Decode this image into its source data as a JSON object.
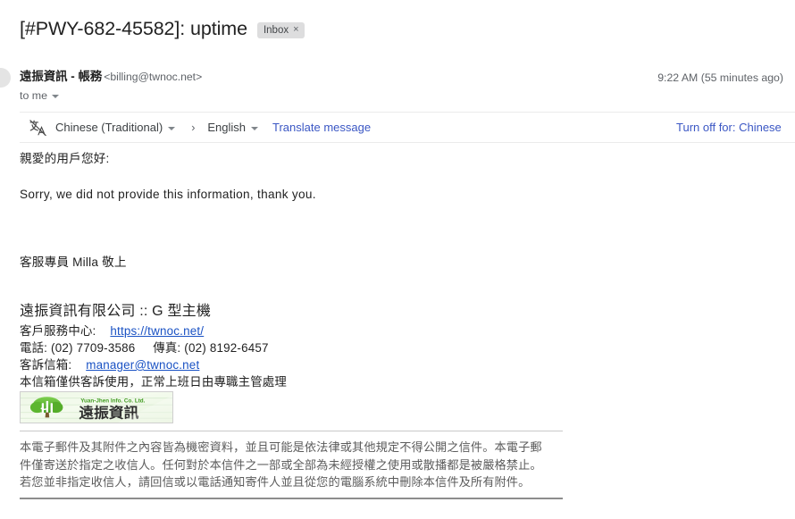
{
  "subject": {
    "text": "[#PWY-682-45582]: uptime",
    "label_chip": "Inbox",
    "label_chip_close": "×"
  },
  "sender": {
    "name": "遠振資訊 - 帳務",
    "email": "<billing@twnoc.net>",
    "recipient": "to me",
    "timestamp": "9:22 AM (55 minutes ago)"
  },
  "translate_bar": {
    "icon": "translate-icon",
    "source_language": "Chinese (Traditional)",
    "arrow": "›",
    "target_language": "English",
    "translate_action": "Translate message",
    "turn_off": "Turn off for: Chinese"
  },
  "message": {
    "greeting": "親愛的用戶您好:",
    "sentence": "Sorry, we did not provide this information, thank you.",
    "sign_off": "客服專員 Milla 敬上"
  },
  "signature": {
    "company_title": "遠振資訊有限公司 :: G 型主機",
    "service_center_label": "客戶服務中心:",
    "service_center_url": "https://twnoc.net/",
    "phone_label": "電話:",
    "phone_value": "(02) 7709-3586",
    "fax_label": "傳真:",
    "fax_value": "(02) 8192-6457",
    "complaint_label": "客訴信箱:",
    "complaint_email": "manager@twnoc.net",
    "complaint_note": "本信箱僅供客訴使用，正常上班日由專職主管處理",
    "logo_top_text": "Yuan-Jhen Info. Co. Ltd.",
    "logo_main_text": "遠振資訊"
  },
  "disclaimer": {
    "line1": "本電子郵件及其附件之內容皆為機密資料，並且可能是依法律或其他規定不得公開之信件。本電子郵",
    "line2": "件僅寄送於指定之收信人。任何對於本信件之一部或全部為未經授權之使用或散播都是被嚴格禁止。",
    "line3": "若您並非指定收信人，請回信或以電話通知寄件人並且從您的電腦系統中刪除本信件及所有附件。"
  },
  "colors": {
    "link_blue": "#3b57c4",
    "sig_link_blue": "#1a52c4",
    "chip_bg": "#ddddde",
    "muted_text": "#5f6368",
    "disclaimer_text": "#5c5c5c",
    "logo_green": "#4caf2a"
  }
}
